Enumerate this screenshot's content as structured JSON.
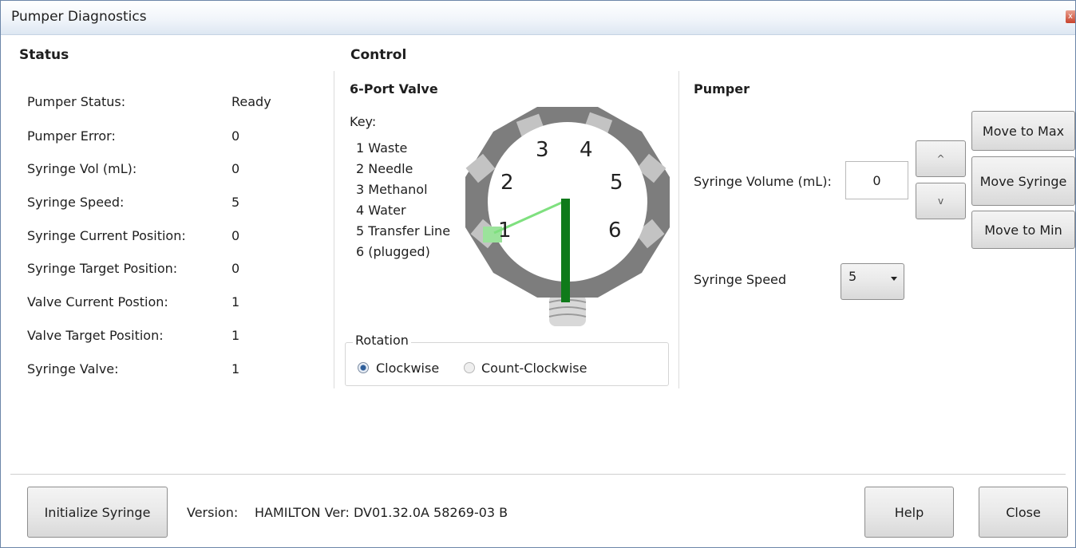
{
  "window": {
    "title": "Pumper Diagnostics",
    "close_glyph": "x"
  },
  "status": {
    "heading": "Status",
    "rows": [
      {
        "label": "Pumper Status:",
        "value": "Ready"
      },
      {
        "label": "Pumper Error:",
        "value": "0"
      },
      {
        "label": "Syringe Vol (mL):",
        "value": "0"
      },
      {
        "label": "Syringe Speed:",
        "value": "5"
      },
      {
        "label": "Syringe Current Position:",
        "value": "0"
      },
      {
        "label": "Syringe Target Position:",
        "value": "0"
      },
      {
        "label": "Valve Current Postion:",
        "value": "1"
      },
      {
        "label": "Valve Target Position:",
        "value": "1"
      },
      {
        "label": "Syringe Valve:",
        "value": "1"
      }
    ]
  },
  "control": {
    "heading": "Control",
    "valve": {
      "heading": "6-Port Valve",
      "key_heading": "Key:",
      "key_items": [
        "1 Waste",
        "2 Needle",
        "3 Methanol",
        "4 Water",
        "5 Transfer Line",
        "6 (plugged)"
      ],
      "port_numbers": [
        "1",
        "2",
        "3",
        "4",
        "5",
        "6"
      ],
      "current_port": 1,
      "colors": {
        "ring": "#7d7d7d",
        "port": "#c3c3c3",
        "needle": "#0f7a1a",
        "active_line": "#7fe07f",
        "active_port": "#9be39b"
      }
    },
    "rotation": {
      "heading": "Rotation",
      "options": [
        {
          "label": "Clockwise",
          "selected": true
        },
        {
          "label": "Count-Clockwise",
          "selected": false
        }
      ]
    }
  },
  "pumper": {
    "heading": "Pumper",
    "syringe_volume_label": "Syringe Volume (mL):",
    "syringe_volume_value": "0",
    "up_glyph": "^",
    "down_glyph": "v",
    "move_to_max": "Move to Max",
    "move_syringe": "Move Syringe",
    "move_to_min": "Move to Min",
    "syringe_speed_label": "Syringe Speed",
    "syringe_speed_value": "5"
  },
  "footer": {
    "initialize_button": "Initialize Syringe",
    "version_label": "Version:",
    "version_value": "HAMILTON Ver: DV01.32.0A 58269-03 B",
    "help_button": "Help",
    "close_button": "Close"
  }
}
